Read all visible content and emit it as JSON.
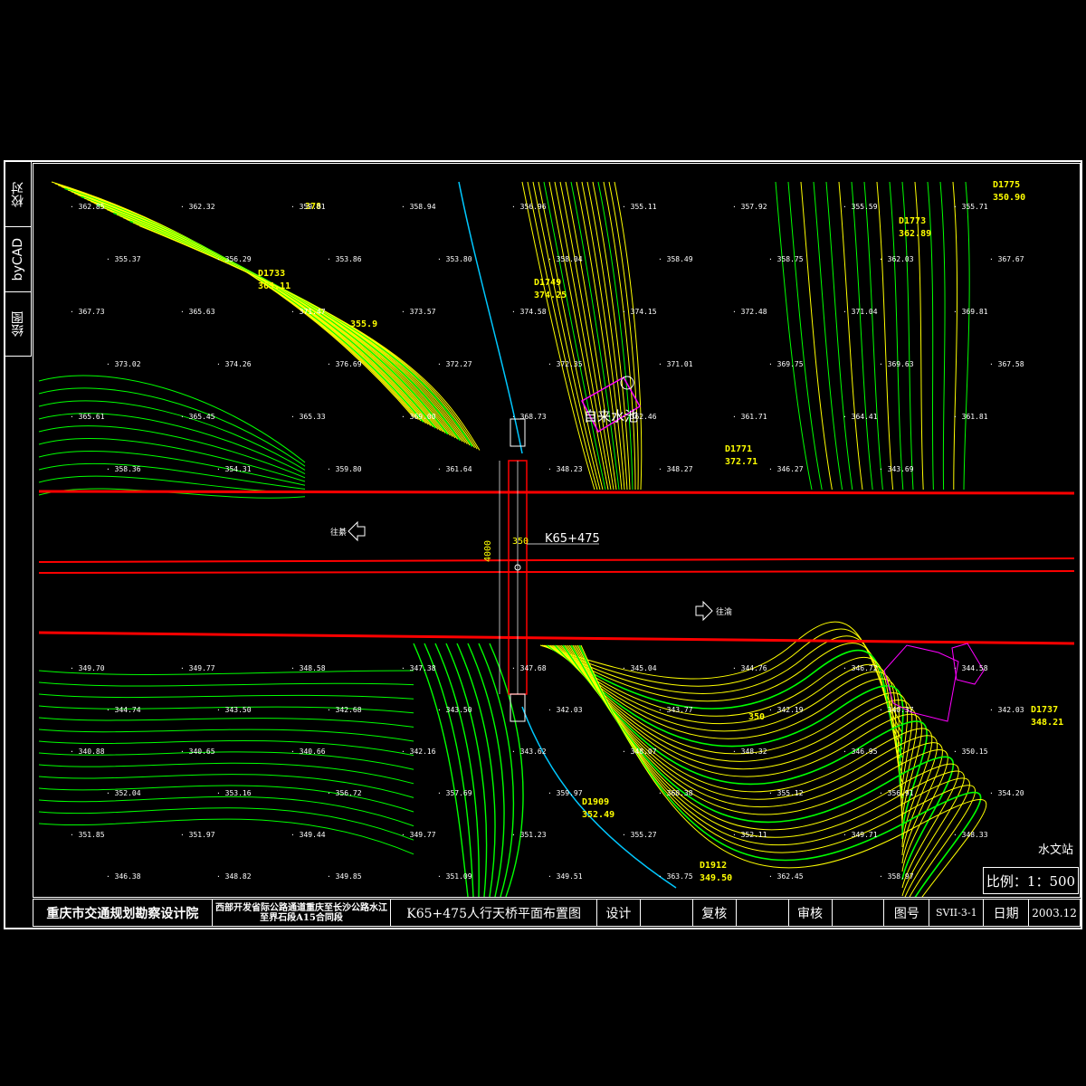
{
  "side_tab": {
    "cells": [
      "校对",
      "byCAD",
      "绘图"
    ]
  },
  "drawing": {
    "station_label": "K65+475",
    "dim_width": "350",
    "dim_length": "4000",
    "water_tank_label": "自来水池",
    "hydro_station_label": "水文站",
    "direction_left": "往綦",
    "direction_right": "往渝",
    "survey_points": [
      {
        "id": "D1733",
        "elev": "365.11"
      },
      {
        "id": "D1749",
        "elev": "374.25"
      },
      {
        "id": "D1771",
        "elev": "372.71"
      },
      {
        "id": "D1773",
        "elev": "362.89"
      },
      {
        "id": "D1775",
        "elev": "350.90"
      },
      {
        "id": "D1909",
        "elev": "352.49"
      },
      {
        "id": "D1912",
        "elev": "349.50"
      },
      {
        "id": "D1737",
        "elev": "348.21"
      }
    ],
    "elevations_top": [
      "362.85",
      "362.32",
      "359.01",
      "358.94",
      "356.96",
      "355.11",
      "357.92",
      "355.59",
      "355.71",
      "355.37",
      "356.29",
      "353.86",
      "353.80",
      "358.04",
      "358.49",
      "358.75",
      "362.03",
      "367.67",
      "367.73",
      "365.63",
      "371.47",
      "373.57",
      "374.58",
      "374.15",
      "372.48",
      "371.04",
      "369.81",
      "373.02",
      "374.26",
      "376.69",
      "372.27",
      "372.35",
      "371.01",
      "369.75",
      "369.63",
      "367.58",
      "365.61",
      "365.45",
      "365.33",
      "369.00",
      "368.73",
      "362.46",
      "361.71",
      "364.41",
      "361.81",
      "358.36",
      "354.31",
      "359.80",
      "361.64",
      "348.23",
      "348.27",
      "346.27",
      "343.69"
    ],
    "elevations_bottom": [
      "349.70",
      "349.77",
      "348.58",
      "347.38",
      "347.68",
      "345.04",
      "344.76",
      "346.72",
      "344.58",
      "344.74",
      "343.50",
      "342.68",
      "343.50",
      "342.03",
      "343.77",
      "342.19",
      "340.37",
      "342.03",
      "340.88",
      "340.65",
      "340.66",
      "342.16",
      "343.62",
      "348.07",
      "348.32",
      "346.95",
      "350.15",
      "352.04",
      "353.16",
      "356.72",
      "357.69",
      "359.97",
      "360.38",
      "355.12",
      "356.91",
      "354.20",
      "351.85",
      "351.97",
      "349.44",
      "349.77",
      "351.23",
      "355.27",
      "352.11",
      "349.71",
      "348.33",
      "346.38",
      "348.82",
      "349.85",
      "351.09",
      "349.51",
      "363.75",
      "362.45",
      "358.97"
    ],
    "contour_value_350": "350",
    "contour_value_355": "355.9",
    "contour_value_378": "378"
  },
  "scale": "比例：1：500",
  "title_block": {
    "institute": "重庆市交通规划勘察设计院",
    "project": "西部开发省际公路通道重庆至长沙公路水江至界石段A15合同段",
    "drawing_title": "K65+475人行天桥平面布置图",
    "design_label": "设计",
    "design_value": "",
    "review_label": "复核",
    "review_value": "",
    "approve_label": "审核",
    "approve_value": "",
    "sheet_no_label": "图号",
    "sheet_no": "SVII-3-1",
    "date_label": "日期",
    "date": "2003.12"
  },
  "colors": {
    "background": "#000000",
    "frame": "#ffffff",
    "contour_yellow": "#ffff00",
    "contour_green": "#00ff00",
    "road_edge": "#ff0000",
    "stream": "#00c8ff",
    "building": "#ff00ff"
  }
}
